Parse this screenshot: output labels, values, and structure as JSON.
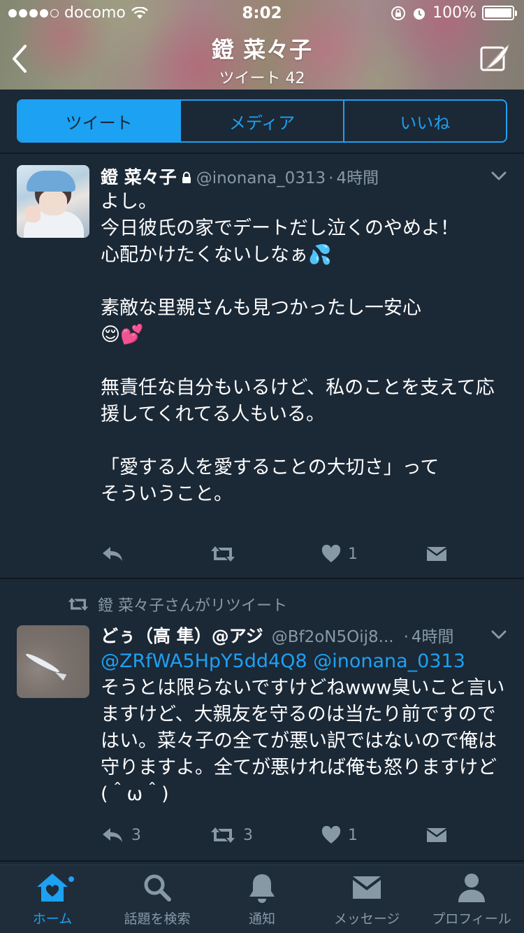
{
  "status_bar": {
    "carrier": "docomo",
    "time": "8:02",
    "battery": "100%"
  },
  "header": {
    "title": "鐙 菜々子",
    "subtitle": "ツイート 42"
  },
  "segments": [
    "ツイート",
    "メディア",
    "いいね"
  ],
  "tweets": [
    {
      "name": "鐙 菜々子",
      "handle": "@inonana_0313",
      "time": "4時間",
      "text": "よし。\n今日彼氏の家でデートだし泣くのやめよ！\n心配かけたくないしなぁ💦\n\n素敵な里親さんも見つかったし一安心\n😌💕\n\n無責任な自分もいるけど、私のことを支えて応援してくれてる人もいる。\n\n「愛する人を愛することの大切さ」って\nそういうこと。",
      "like_count": "1"
    },
    {
      "retweet_banner": "鐙 菜々子さんがリツイート",
      "name": "どぅ（高 隼）@アジ",
      "handle": "@Bf2oN5Oij8...",
      "time": "4時間",
      "mentions": "@ZRfWA5HpY5dd4Q8 @inonana_0313",
      "text": "そうとは限らないですけどねwww臭いこと言いますけど、大親友を守るのは当たり前ですのではい。菜々子の全てが悪い訳ではないので俺は守りますよ。全てが悪ければ俺も怒りますけど(＾ω＾)",
      "reply_count": "3",
      "retweet_count": "3",
      "like_count": "1"
    }
  ],
  "tabbar": {
    "home": "ホーム",
    "search": "話題を検索",
    "notifications": "通知",
    "messages": "メッセージ",
    "profile": "プロフィール"
  },
  "colors": {
    "accent": "#1da1f2",
    "background": "#1b2836",
    "muted": "#8899a6"
  }
}
